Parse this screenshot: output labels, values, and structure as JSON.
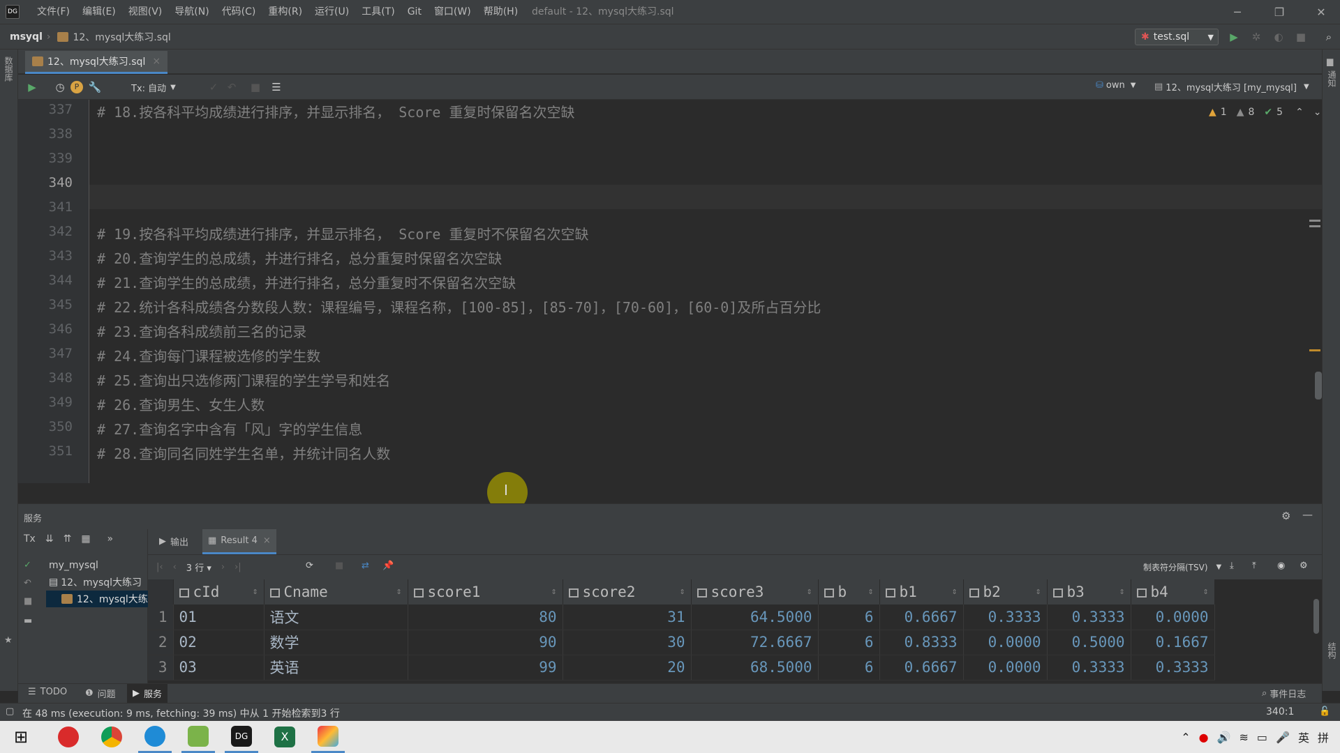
{
  "menubar": {
    "items": [
      "文件(F)",
      "编辑(E)",
      "视图(V)",
      "导航(N)",
      "代码(C)",
      "重构(R)",
      "运行(U)",
      "工具(T)",
      "Git",
      "窗口(W)",
      "帮助(H)"
    ],
    "title": "default - 12、mysql大练习.sql",
    "app_icon": "DG"
  },
  "nav": {
    "project": "msyql",
    "file": "12、mysql大练习.sql",
    "run_config": "test.sql"
  },
  "editor_tab": {
    "label": "12、mysql大练习.sql"
  },
  "editor_toolbar": {
    "tx": "Tx: 自动",
    "schema_owner": "own",
    "datasource": "12、mysql大练习 [my_mysql]"
  },
  "inspections": {
    "warn1": "1",
    "warn2": "8",
    "ok": "5"
  },
  "left_tool": {
    "label": "数据库"
  },
  "right_tool": {
    "label": "通知",
    "bottom_label": "结构"
  },
  "code_lines": [
    {
      "n": "337",
      "text": "# 18.按各科平均成绩进行排序，并显示排名， Score 重复时保留名次空缺"
    },
    {
      "n": "338",
      "text": ""
    },
    {
      "n": "339",
      "text": ""
    },
    {
      "n": "340",
      "text": ""
    },
    {
      "n": "341",
      "text": ""
    },
    {
      "n": "342",
      "text": "# 19.按各科平均成绩进行排序，并显示排名， Score 重复时不保留名次空缺"
    },
    {
      "n": "343",
      "text": "# 20.查询学生的总成绩，并进行排名，总分重复时保留名次空缺"
    },
    {
      "n": "344",
      "text": "# 21.查询学生的总成绩，并进行排名，总分重复时不保留名次空缺"
    },
    {
      "n": "345",
      "text": "# 22.统计各科成绩各分数段人数：课程编号，课程名称，[100-85]，[85-70]，[70-60]，[60-0]及所占百分比"
    },
    {
      "n": "346",
      "text": "# 23.查询各科成绩前三名的记录"
    },
    {
      "n": "347",
      "text": "# 24.查询每门课程被选修的学生数"
    },
    {
      "n": "348",
      "text": "# 25.查询出只选修两门课程的学生学号和姓名"
    },
    {
      "n": "349",
      "text": "# 26.查询男生、女生人数"
    },
    {
      "n": "350",
      "text": "# 27.查询名字中含有「风」字的学生信息"
    },
    {
      "n": "351",
      "text": "# 28.查询同名同姓学生名单，并统计同名人数"
    }
  ],
  "services": {
    "title": "服务",
    "tx": "Tx",
    "tree": [
      "my_mysql",
      "12、mysql大练习",
      "12、mysql大练"
    ]
  },
  "result": {
    "tab_output": "输出",
    "tab_result": "Result 4",
    "rows_label": "3 行",
    "export_format": "制表符分隔(TSV)",
    "columns": [
      "cId",
      "Cname",
      "score1",
      "score2",
      "score3",
      "b",
      "b1",
      "b2",
      "b3",
      "b4"
    ],
    "rows": [
      {
        "n": "1",
        "cells": [
          "01",
          "语文",
          "80",
          "31",
          "64.5000",
          "6",
          "0.6667",
          "0.3333",
          "0.3333",
          "0.0000"
        ]
      },
      {
        "n": "2",
        "cells": [
          "02",
          "数学",
          "90",
          "30",
          "72.6667",
          "6",
          "0.8333",
          "0.0000",
          "0.5000",
          "0.1667"
        ]
      },
      {
        "n": "3",
        "cells": [
          "03",
          "英语",
          "99",
          "20",
          "68.5000",
          "6",
          "0.6667",
          "0.0000",
          "0.3333",
          "0.3333"
        ]
      }
    ]
  },
  "bottom_tabs": {
    "todo": "TODO",
    "problems": "问题",
    "services": "服务",
    "event_log": "事件日志"
  },
  "status": {
    "message": "在 48 ms (execution: 9 ms, fetching: 39 ms) 中从 1 开始检索到3 行",
    "position": "340:1"
  },
  "taskbar": {
    "ime": "英",
    "ime2": "拼"
  },
  "colors": {
    "accent": "#4a88c7",
    "comment": "#808080",
    "number": "#6897bb",
    "run": "#59a869"
  }
}
